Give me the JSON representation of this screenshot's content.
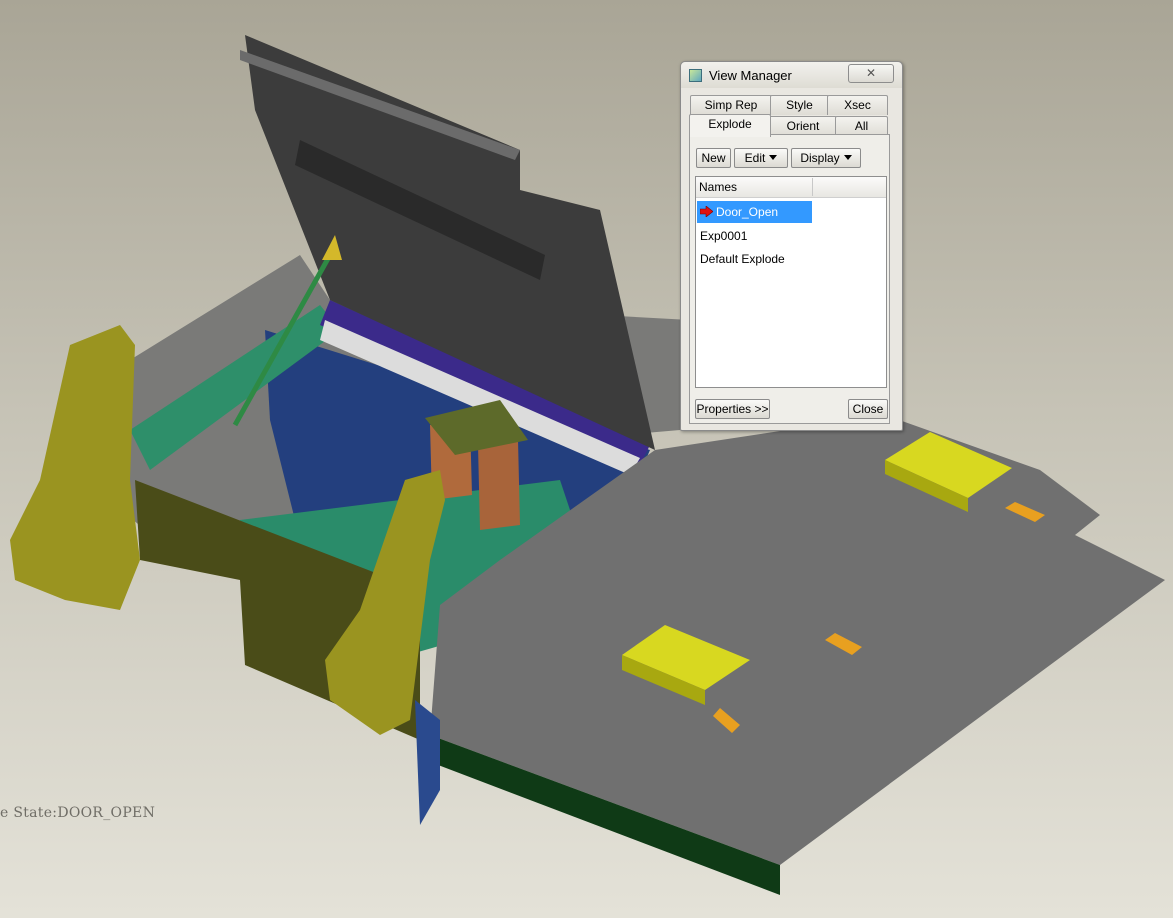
{
  "viewport": {
    "state_label": "e State:DOOR_OPEN"
  },
  "view_manager": {
    "title": "View Manager",
    "title_icon": "view-manager-icon",
    "close_glyph": "✕",
    "tabs_row1": [
      "Simp Rep",
      "Style",
      "Xsec"
    ],
    "tabs_row2": [
      "Explode",
      "Orient",
      "All"
    ],
    "active_tab": "Explode",
    "toolbar": {
      "new_label": "New",
      "edit_label": "Edit",
      "display_label": "Display"
    },
    "list": {
      "header": "Names",
      "items": [
        "Door_Open",
        "Exp0001",
        "Default Explode"
      ],
      "selected": "Door_Open",
      "active_marker_icon": "red-arrow-icon"
    },
    "footer": {
      "properties_label": "Properties >>",
      "close_label": "Close"
    }
  },
  "colors": {
    "selection": "#3399ff",
    "plate_gray": "#6e6e6e",
    "bracket_olive": "#8e8a1c",
    "yellow_pad": "#d4d41a",
    "door_dark": "#3a3a3a",
    "frame_green": "#2f8f6f",
    "panel_blue": "#1f3b7a"
  }
}
